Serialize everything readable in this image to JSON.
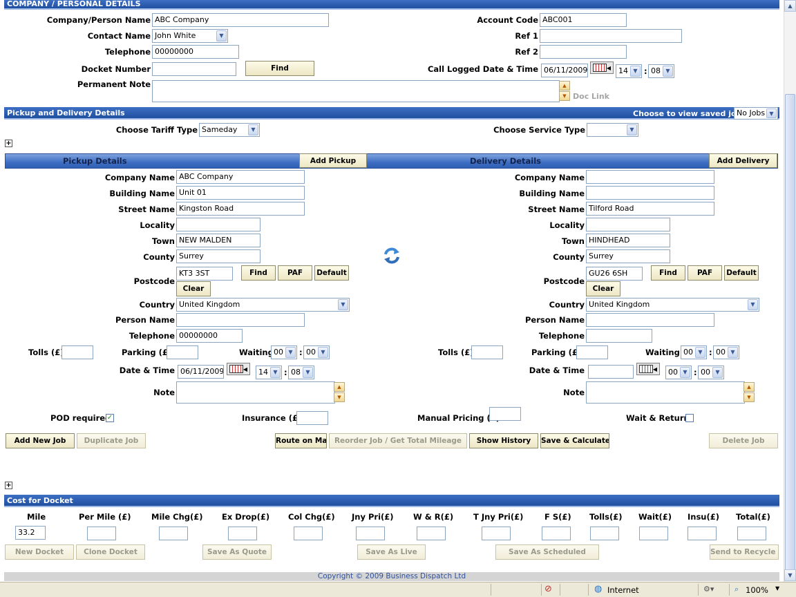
{
  "company": {
    "section_title": "COMPANY / PERSONAL DETAILS",
    "company_label": "Company/Person Name",
    "company_value": "ABC Company",
    "contact_label": "Contact Name",
    "contact_value": "John White",
    "telephone_label": "Telephone",
    "telephone_value": "00000000",
    "docket_label": "Docket Number",
    "docket_value": "",
    "find_label": "Find",
    "note_label": "Permanent Note",
    "doc_link": "Doc Link",
    "account_label": "Account Code",
    "account_value": "ABC001",
    "ref1_label": "Ref 1",
    "ref2_label": "Ref 2",
    "call_logged_label": "Call Logged Date & Time",
    "call_date": "06/11/2009",
    "call_hour": "14",
    "call_min": "08",
    "colon": ":"
  },
  "pd": {
    "section_title": "Pickup and Delivery Details",
    "choose_view_label": "Choose to view saved job",
    "choose_view_value": "No Jobs",
    "tariff_label": "Choose Tariff Type",
    "tariff_value": "Sameday",
    "service_label": "Choose Service Type",
    "service_value": "",
    "plus": "+"
  },
  "pickup": {
    "title": "Pickup Details",
    "add_label": "Add Pickup",
    "company_label": "Company Name",
    "company": "ABC Company",
    "building_label": "Building Name",
    "building": "Unit 01",
    "street_label": "Street Name",
    "street": "Kingston Road",
    "locality_label": "Locality",
    "locality": "",
    "town_label": "Town",
    "town": "NEW MALDEN",
    "county_label": "County",
    "county": "Surrey",
    "postcode_label": "Postcode",
    "postcode": "KT3 3ST",
    "find": "Find",
    "paf": "PAF",
    "default": "Default",
    "clear": "Clear",
    "country_label": "Country",
    "country": "United Kingdom",
    "person_label": "Person Name",
    "person": "",
    "telephone_label": "Telephone",
    "telephone": "00000000",
    "tolls_label": "Tolls (£)",
    "parking_label": "Parking (£)",
    "waiting_label": "Waiting",
    "wait_h": "00",
    "wait_m": "00",
    "datetime_label": "Date & Time",
    "date": "06/11/2009",
    "hour": "14",
    "min": "08",
    "note_label": "Note"
  },
  "delivery": {
    "title": "Delivery Details",
    "add_label": "Add Delivery",
    "company_label": "Company Name",
    "company": "",
    "building_label": "Building Name",
    "building": "",
    "street_label": "Street Name",
    "street": "Tilford Road",
    "locality_label": "Locality",
    "locality": "",
    "town_label": "Town",
    "town": "HINDHEAD",
    "county_label": "County",
    "county": "Surrey",
    "postcode_label": "Postcode",
    "postcode": "GU26 6SH",
    "find": "Find",
    "paf": "PAF",
    "default": "Default",
    "clear": "Clear",
    "country_label": "Country",
    "country": "United Kingdom",
    "person_label": "Person Name",
    "person": "",
    "telephone_label": "Telephone",
    "telephone": "",
    "tolls_label": "Tolls (£)",
    "parking_label": "Parking (£)",
    "waiting_label": "Waiting",
    "wait_h": "00",
    "wait_m": "00",
    "datetime_label": "Date & Time",
    "date": "",
    "hour": "00",
    "min": "00",
    "note_label": "Note"
  },
  "options": {
    "pod_label": "POD required",
    "pod_checked": true,
    "insurance_label": "Insurance (£)",
    "manual_label": "Manual Pricing (£)",
    "wait_return_label": "Wait & Return"
  },
  "actions": {
    "add_new_job": "Add New Job",
    "duplicate_job": "Duplicate Job",
    "route_on_map": "Route on Map",
    "reorder": "Reorder Job / Get Total Mileage",
    "show_history": "Show History",
    "save_calculate": "Save & Calculate",
    "delete_job": "Delete Job"
  },
  "cost": {
    "section_title": "Cost for Docket",
    "headers": [
      "Mile",
      "Per Mile (£)",
      "Mile Chg(£)",
      "Ex Drop(£)",
      "Col Chg(£)",
      "Jny Pri(£)",
      "W & R(£)",
      "T Jny Pri(£)",
      "F S(£)",
      "Tolls(£)",
      "Wait(£)",
      "Insu(£)",
      "Total(£)"
    ],
    "mile_value": "33.2",
    "new_docket": "New Docket",
    "clone_docket": "Clone Docket",
    "save_quote": "Save As Quote",
    "save_live": "Save As Live",
    "save_scheduled": "Save As Scheduled",
    "recycle": "Send to Recycle Bin"
  },
  "footer": {
    "copyright": "Copyright © 2009 Business Dispatch Ltd"
  },
  "status": {
    "zone": "Internet",
    "zoom": "100%"
  },
  "colors": {
    "header_blue": "#1f4f9f",
    "button_bg": "#ede7c4"
  }
}
